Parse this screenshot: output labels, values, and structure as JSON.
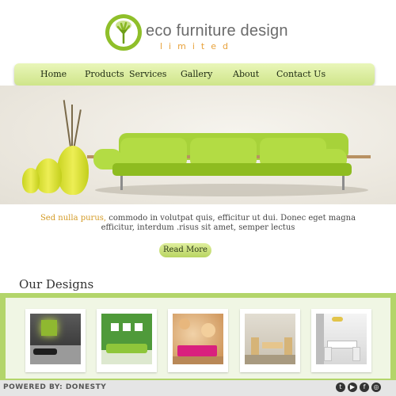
{
  "brand": {
    "title": "eco furniture design",
    "subtitle": "limited"
  },
  "nav": {
    "items": [
      "Home",
      "Products",
      "Services",
      "Gallery",
      "About",
      "Contact Us"
    ]
  },
  "hero": {
    "intro_lead": "Sed nulla purus,",
    "intro_text": " commodo in volutpat quis, efficitur ut dui. Donec eget magna efficitur, interdum .risus sit amet, semper lectus",
    "read_more": "Read More"
  },
  "designs": {
    "title": "Our Designs",
    "thumbnails": [
      {
        "name": "dark living room with lounge chair"
      },
      {
        "name": "green wall with green sofa"
      },
      {
        "name": "floral mural with pink sofa"
      },
      {
        "name": "wooden dining set"
      },
      {
        "name": "white modern dining room"
      }
    ]
  },
  "footer": {
    "powered_by": "POWERED BY: DONESTY",
    "social": [
      "twitter",
      "youtube",
      "facebook",
      "instagram"
    ]
  },
  "colors": {
    "accent_green": "#b3d56a",
    "nav_green": "#d8ec9f",
    "lead_orange": "#d39a24"
  }
}
